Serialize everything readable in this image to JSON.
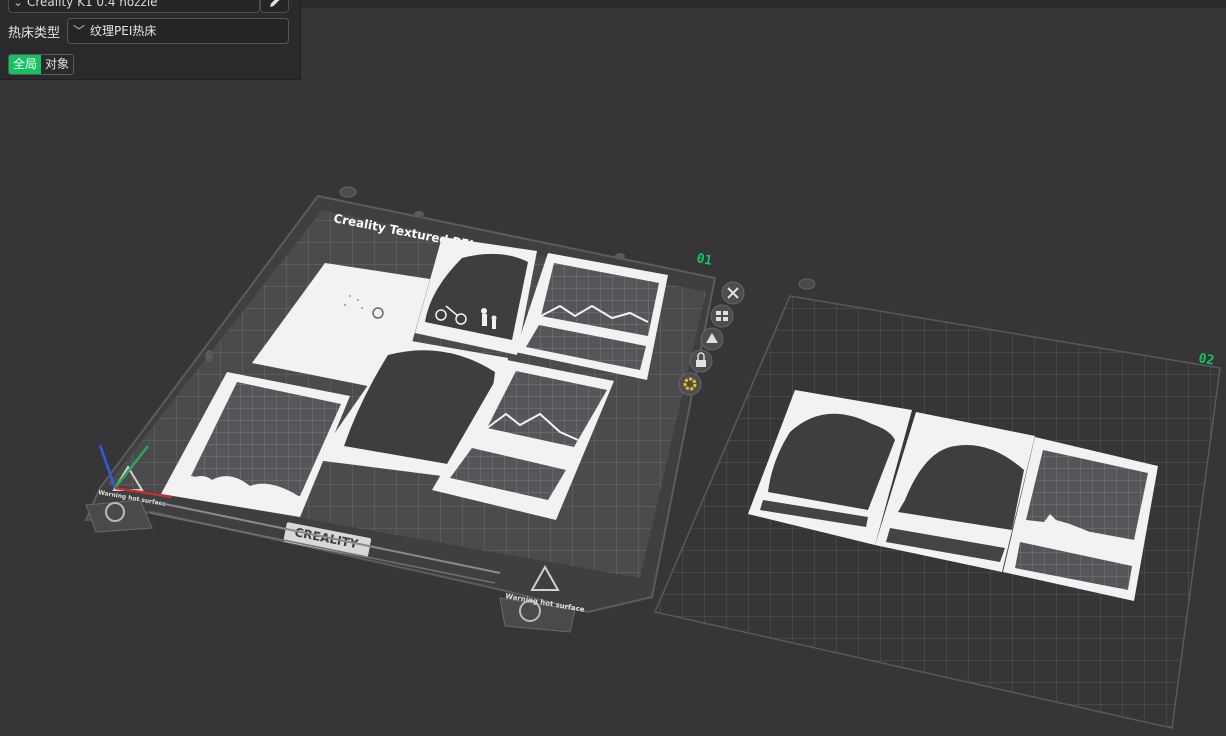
{
  "toolbar": {
    "printer_label": "Creality K1 0.4 nozzle",
    "bed_type_label": "热床类型",
    "bed_type_value": "纹理PEI热床",
    "scope_global": "全局",
    "scope_object": "对象"
  },
  "plates": [
    {
      "number": "01",
      "bed_logo": "CREALITY",
      "bed_title": "Creality Textured PEI",
      "warning_text": "Warning hot surface"
    },
    {
      "number": "02"
    }
  ],
  "icons": {
    "edit": "pencil-icon",
    "dropdown": "chevron-down-icon",
    "plate_tools": [
      "close-icon",
      "arrange-icon",
      "orient-icon",
      "lock-icon",
      "settings-icon"
    ]
  },
  "colors": {
    "accent": "#16c15f",
    "plate_number": "#18c25e",
    "background": "#363638",
    "model": "#f2f2f2"
  }
}
